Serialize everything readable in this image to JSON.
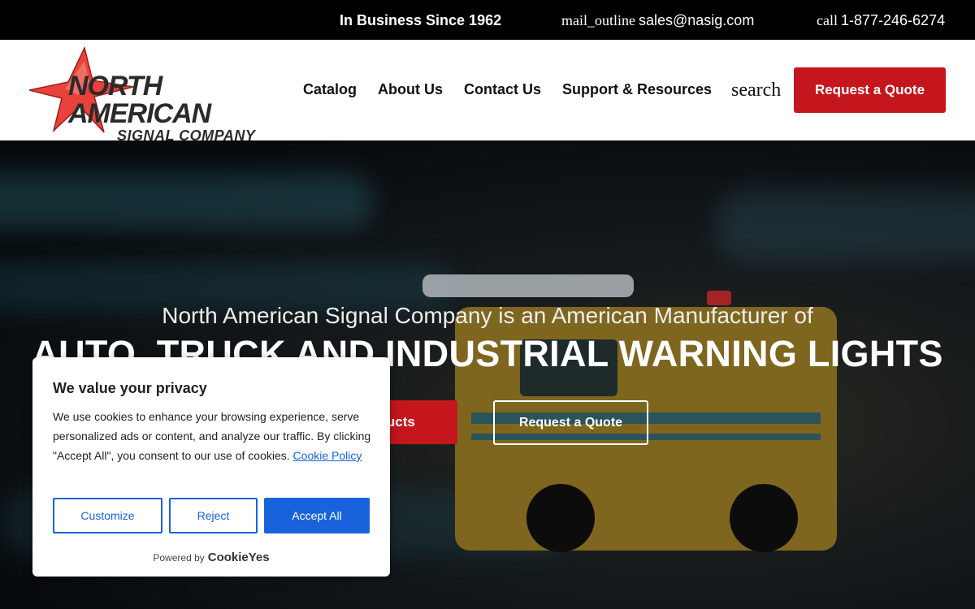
{
  "topbar": {
    "since": "In Business Since 1962",
    "email_icon": "mail_outline",
    "email": "sales@nasig.com",
    "phone_icon": "call",
    "phone": "1-877-246-6274"
  },
  "header": {
    "logo_line1": "NORTH AMERICAN",
    "logo_line2": "SIGNAL COMPANY",
    "nav": [
      "Catalog",
      "About Us",
      "Contact Us",
      "Support & Resources"
    ],
    "search_label": "search",
    "quote_button": "Request a Quote"
  },
  "hero": {
    "subtitle": "North American Signal Company is an American Manufacturer of",
    "title": "AUTO, TRUCK AND INDUSTRIAL WARNING LIGHTS",
    "products_button": "oducts",
    "quote_button": "Request a Quote"
  },
  "cookie": {
    "title": "We value your privacy",
    "body": "We use cookies to enhance your browsing experience, serve personalized ads or content, and analyze our traffic. By clicking \"Accept All\", you consent to our use of cookies.",
    "policy_link": "Cookie Policy",
    "customize": "Customize",
    "reject": "Reject",
    "accept": "Accept All",
    "powered_by": "Powered by",
    "brand": "CookieYes"
  },
  "colors": {
    "accent_red": "#c5161d",
    "cookie_blue": "#1863dc",
    "logo_red": "#e8423a"
  }
}
